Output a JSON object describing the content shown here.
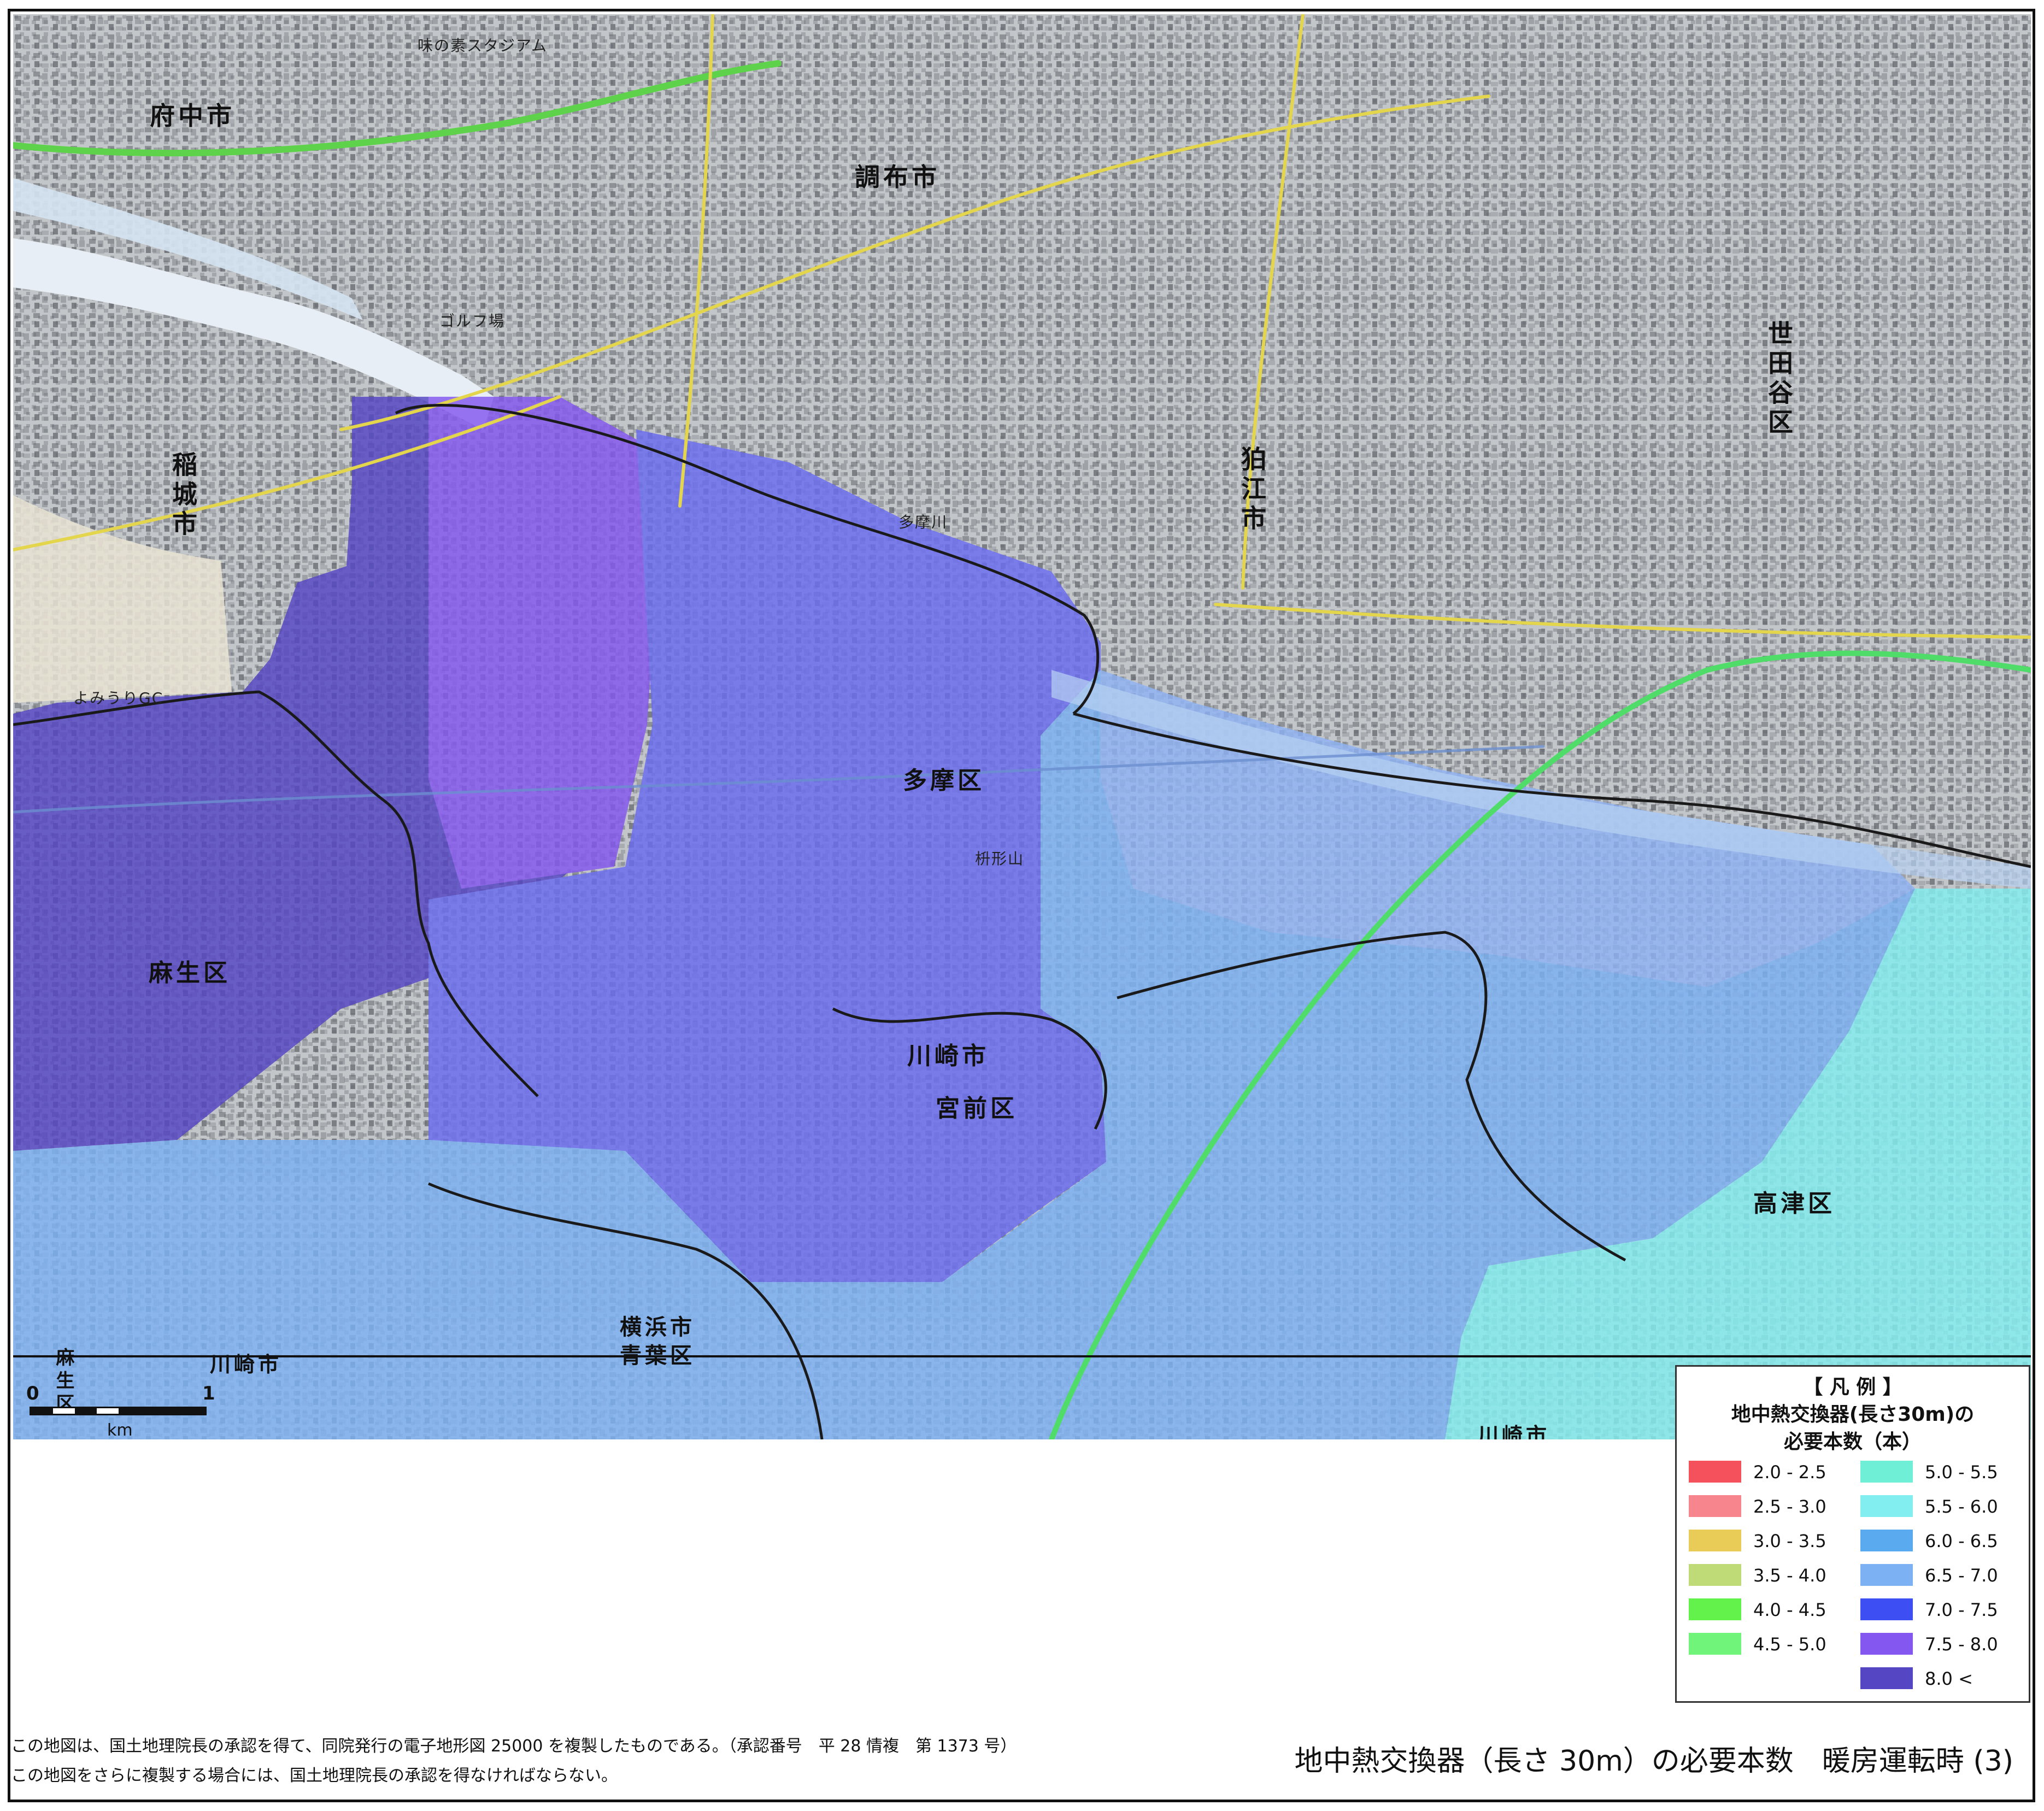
{
  "map": {
    "places": {
      "fuchu": "府中市",
      "chofu": "調布市",
      "setagaya": "世田谷区",
      "komae": "狛江市",
      "inagi": "稲城市",
      "tama": "多摩区",
      "asao": "麻生区",
      "kawasaki": "川崎市",
      "miyamae": "宮前区",
      "takatsu": "高津区",
      "yokohama": "横浜市",
      "aoba": "青葉区",
      "kawasaki_corner": "川崎市",
      "kawasaki_bottom": "川崎市",
      "asao_corner": "麻生区"
    },
    "small_labels": {
      "tamagawa": "多摩川",
      "golf": "ゴルフ場",
      "yomiuri": "よみうりGC",
      "stadium": "味の素スタジアム",
      "kasumi": "枡形山"
    },
    "scale": {
      "zero": "0",
      "one": "1",
      "unit": "km"
    }
  },
  "legend": {
    "heading": "【 凡 例 】",
    "line1": "地中熱交換器(長さ30m)の",
    "line2": "必要本数（本）",
    "items_left": [
      {
        "label": "2.0 - 2.5",
        "color": "#f4515c"
      },
      {
        "label": "2.5 - 3.0",
        "color": "#f7858e"
      },
      {
        "label": "3.0 - 3.5",
        "color": "#e9cc58"
      },
      {
        "label": "3.5 - 4.0",
        "color": "#bedb77"
      },
      {
        "label": "4.0 - 4.5",
        "color": "#63f14c"
      },
      {
        "label": "4.5 - 5.0",
        "color": "#70f57a"
      }
    ],
    "items_right": [
      {
        "label": "5.0 - 5.5",
        "color": "#6ff0d6"
      },
      {
        "label": "5.5 - 6.0",
        "color": "#83eef0"
      },
      {
        "label": "6.0 - 6.5",
        "color": "#5aaaf0"
      },
      {
        "label": "6.5 - 7.0",
        "color": "#7cb1f4"
      },
      {
        "label": "7.0 - 7.5",
        "color": "#3d4ef3"
      },
      {
        "label": "7.5 - 8.0",
        "color": "#8457f0"
      },
      {
        "label": "8.0 <",
        "color": "#5546c4"
      }
    ]
  },
  "footer": {
    "credit1": "この地図は、国土地理院長の承認を得て、同院発行の電子地形図 25000 を複製したものである。（承認番号　平 28 情複　第 1373 号）",
    "credit2": "この地図をさらに複製する場合には、国土地理院長の承認を得なければならない。",
    "title": "地中熱交換器（長さ 30m）の必要本数　暖房運転時 (3)"
  }
}
